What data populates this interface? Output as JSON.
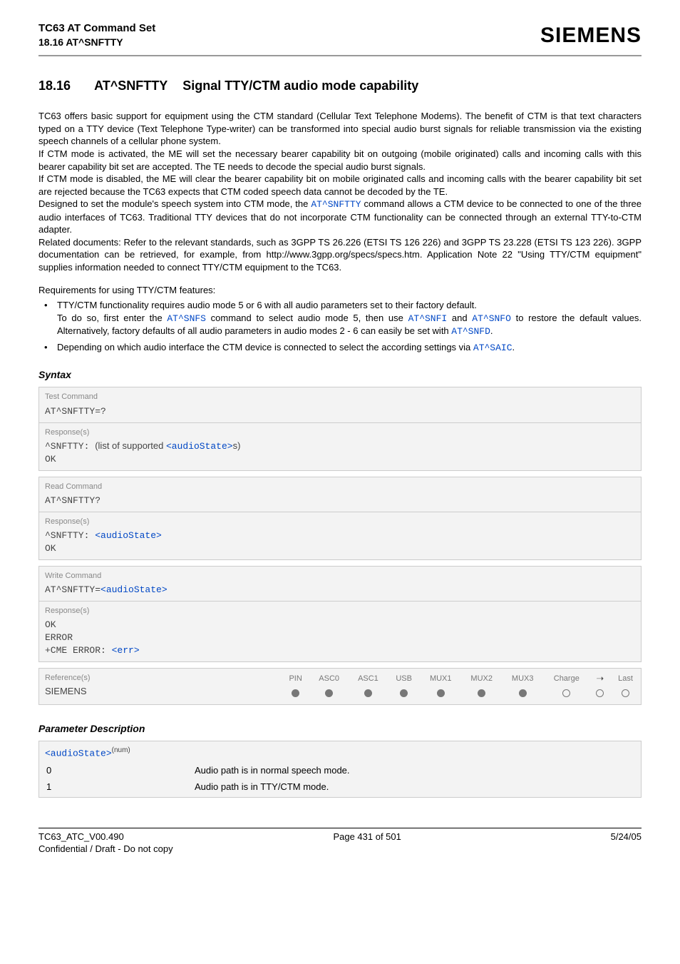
{
  "header": {
    "doc_title": "TC63 AT Command Set",
    "doc_sub": "18.16 AT^SNFTTY",
    "brand": "SIEMENS"
  },
  "section": {
    "number": "18.16",
    "command": "AT^SNFTTY",
    "title": "Signal TTY/CTM audio mode capability"
  },
  "body": {
    "p1": "TC63 offers basic support for equipment using the CTM standard (Cellular Text Telephone Modems). The benefit of CTM is that text characters typed on a TTY device (Text Telephone Type-writer) can be transformed into special audio burst signals for reliable transmission via the existing speech channels of a cellular phone system.",
    "p2": "If CTM mode is activated, the ME will set the necessary bearer capability bit on outgoing (mobile originated) calls and incoming calls with this bearer capability bit set are accepted. The TE needs to decode the special audio burst signals.",
    "p3": "If CTM mode is disabled, the ME will clear the bearer capability bit on mobile originated calls and incoming calls with the bearer capability bit set are rejected because the TC63 expects that CTM coded speech data cannot be decoded by the TE.",
    "p4a": "Designed to set the module's speech system into CTM mode, the ",
    "p4_cmd": "AT^SNFTTY",
    "p4b": " command allows a CTM device to be connected to one of the three audio interfaces of TC63. Traditional TTY devices that do not incorporate CTM functionality can be connected through an external TTY-to-CTM adapter.",
    "p5": "Related documents: Refer to the relevant standards, such as 3GPP TS 26.226 (ETSI TS 126 226) and 3GPP TS 23.228 (ETSI TS 123 226). 3GPP documentation can be retrieved, for example, from http://www.3gpp.org/specs/specs.htm. Application Note 22 \"Using TTY/CTM equipment\" supplies information needed to connect TTY/CTM equipment to the TC63.",
    "req_intro": "Requirements for using TTY/CTM features:",
    "req1a": "TTY/CTM functionality requires audio mode 5 or 6 with all audio parameters set to their factory default.",
    "req1b_pre": "To do so, first enter the ",
    "req1b_cmd1": "AT^SNFS",
    "req1b_mid1": " command to select audio mode 5, then use ",
    "req1b_cmd2": "AT^SNFI",
    "req1b_mid2": " and ",
    "req1b_cmd3": "AT^SNFO",
    "req1b_mid3": " to restore the default values. Alternatively, factory defaults of all audio parameters in audio modes 2 - 6 can easily be set with ",
    "req1b_cmd4": "AT^SNFD",
    "req1b_end": ".",
    "req2a": "Depending on which audio interface the CTM device is connected to select the according settings via ",
    "req2_cmd": "AT^SAIC",
    "req2_end": "."
  },
  "syntax": {
    "heading": "Syntax",
    "test_label": "Test Command",
    "test_cmd": "AT^SNFTTY=?",
    "responses_label": "Response(s)",
    "test_resp_pre": "^SNFTTY: ",
    "test_resp_mid": "(list of supported ",
    "audiostate_param": "<audioState>",
    "test_resp_suf": "s)",
    "ok": "OK",
    "read_label": "Read Command",
    "read_cmd": "AT^SNFTTY?",
    "read_resp_pre": "^SNFTTY: ",
    "write_label": "Write Command",
    "write_cmd_pre": "AT^SNFTTY=",
    "error": "ERROR",
    "cme_pre": "+CME ERROR: ",
    "err_param": "<err>",
    "references_label": "Reference(s)",
    "siemens": "SIEMENS",
    "cols": {
      "pin": "PIN",
      "asc0": "ASC0",
      "asc1": "ASC1",
      "usb": "USB",
      "mux1": "MUX1",
      "mux2": "MUX2",
      "mux3": "MUX3",
      "charge": "Charge",
      "arrow": "➝",
      "last": "Last"
    }
  },
  "params": {
    "heading": "Parameter Description",
    "name": "<audioState>",
    "sup": "(num)",
    "rows": [
      {
        "val": "0",
        "desc": "Audio path is in normal speech mode."
      },
      {
        "val": "1",
        "desc": "Audio path is in TTY/CTM mode."
      }
    ]
  },
  "footer": {
    "left": "TC63_ATC_V00.490",
    "center": "Page 431 of 501",
    "right": "5/24/05",
    "left2": "Confidential / Draft - Do not copy"
  }
}
